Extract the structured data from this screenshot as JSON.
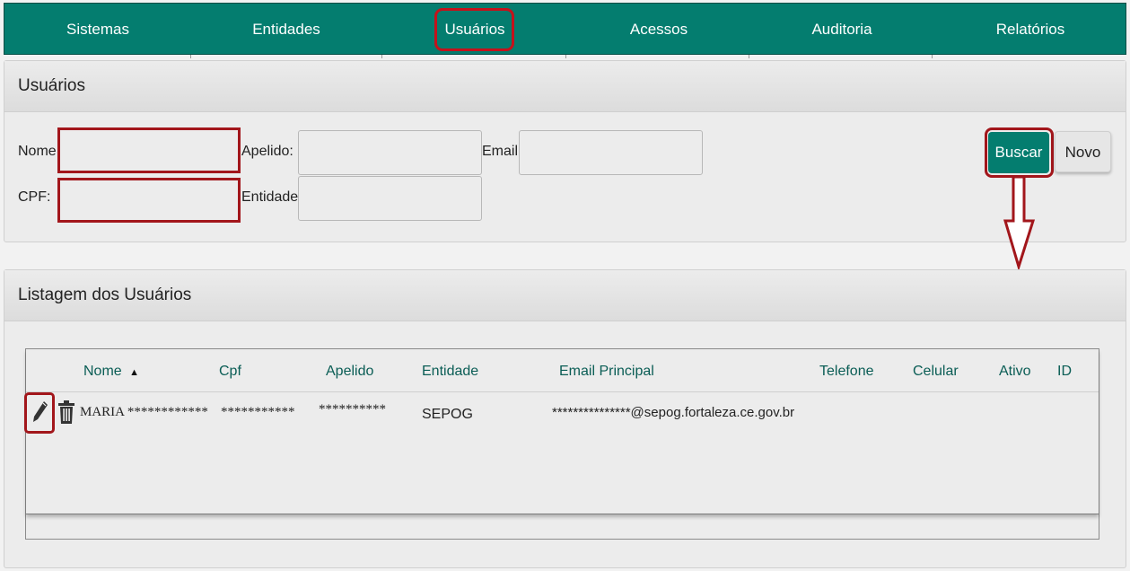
{
  "nav": {
    "items": [
      "Sistemas",
      "Entidades",
      "Usuários",
      "Acessos",
      "Auditoria",
      "Relatórios"
    ]
  },
  "search_panel": {
    "title": "Usuários",
    "labels": {
      "nome": "Nome:",
      "apelido": "Apelido:",
      "email": "Email:",
      "cpf": "CPF:",
      "entidade": "Entidade:"
    },
    "values": {
      "nome": "",
      "apelido": "",
      "email": "",
      "cpf": "",
      "entidade": ""
    },
    "buttons": {
      "buscar": "Buscar",
      "novo": "Novo"
    }
  },
  "list_panel": {
    "title": "Listagem dos Usuários",
    "columns": [
      "Nome",
      "Cpf",
      "Apelido",
      "Entidade",
      "Email Principal",
      "Telefone",
      "Celular",
      "Ativo",
      "ID"
    ],
    "sort_indicator": "▲",
    "rows": [
      {
        "nome": "MARIA ************",
        "cpf": "***********",
        "apelido": "**********",
        "entidade": "SEPOG",
        "email": "***************@sepog.fortaleza.ce.gov.br",
        "telefone": "",
        "celular": "",
        "ativo": "",
        "id": ""
      }
    ]
  },
  "colors": {
    "accent": "#047d6f",
    "highlight": "#a2161b",
    "header_text": "#0a5d55"
  },
  "icons": [
    "edit-pencil-icon",
    "trash-icon",
    "arrow-down-icon",
    "sort-up-icon"
  ]
}
